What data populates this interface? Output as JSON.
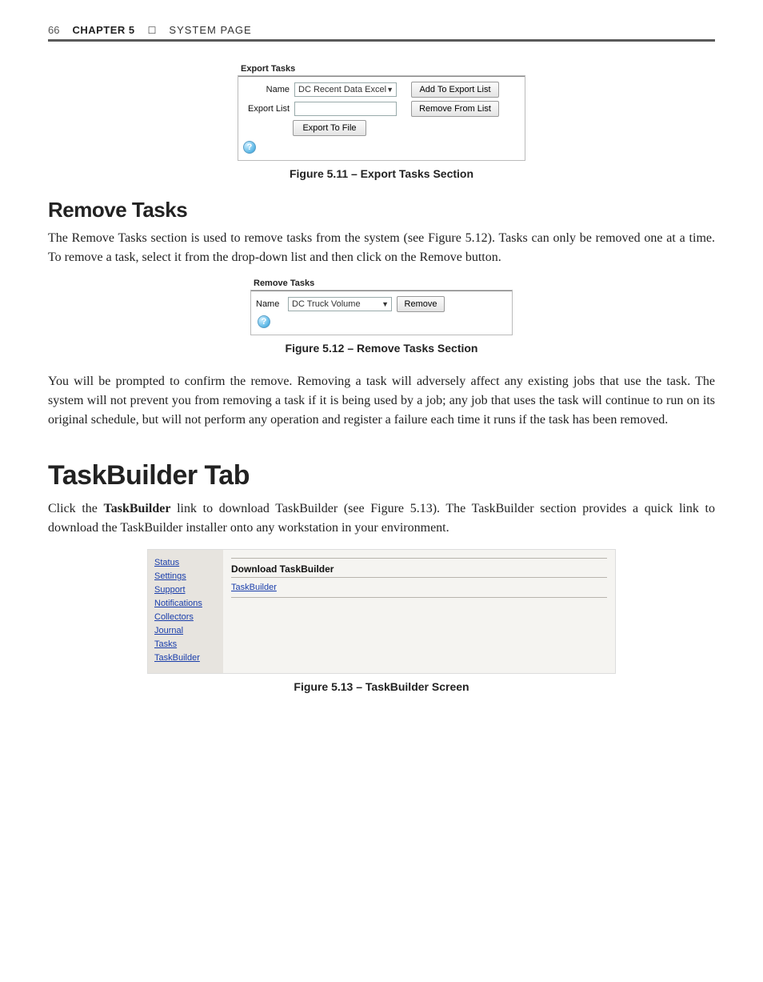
{
  "header": {
    "page_number": "66",
    "chapter_label": "CHAPTER 5",
    "separator": "☐",
    "chapter_title": "SYSTEM PAGE"
  },
  "fig511": {
    "panel_title": "Export Tasks",
    "name_label": "Name",
    "name_value": "DC Recent Data Excel",
    "add_btn": "Add To Export List",
    "export_list_label": "Export List",
    "remove_btn": "Remove From List",
    "export_file_btn": "Export To File",
    "help": "?",
    "caption": "Figure 5.11 – Export Tasks Section"
  },
  "remove_section": {
    "heading": "Remove Tasks",
    "para": "The Remove Tasks section is used to remove tasks from the system (see Figure 5.12). Tasks can only be removed one at a time. To remove a task, select it from the drop-down list and then click on the Remove button."
  },
  "fig512": {
    "panel_title": "Remove Tasks",
    "name_label": "Name",
    "name_value": "DC Truck Volume",
    "remove_btn": "Remove",
    "help": "?",
    "caption": "Figure 5.12 – Remove Tasks Section"
  },
  "post_remove_para": "You will be prompted to confirm the remove. Removing a task will adversely affect any existing jobs that use the task. The system will not prevent you from removing a task if it is being used by a job; any job that uses the task will continue to run on its original schedule, but will not perform any operation and register a failure each time it runs if the task has been removed.",
  "taskbuilder_section": {
    "heading": "TaskBuilder Tab",
    "para_pre": "Click the ",
    "para_bold": "TaskBuilder",
    "para_post": " link to download TaskBuilder (see Figure 5.13). The TaskBuilder section provides a quick link to download the TaskBuilder installer onto any workstation in your environment."
  },
  "fig513": {
    "sidebar": [
      "Status",
      "Settings",
      "Support",
      "Notifications",
      "Collectors",
      "Journal",
      "Tasks",
      "TaskBuilder"
    ],
    "download_title": "Download TaskBuilder",
    "download_link": "TaskBuilder",
    "caption": "Figure 5.13 – TaskBuilder Screen"
  }
}
